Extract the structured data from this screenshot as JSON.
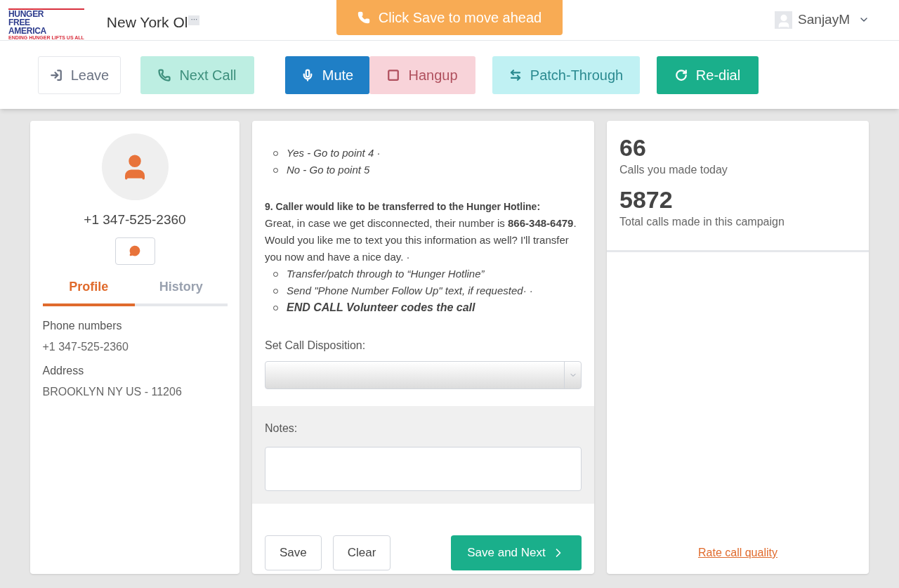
{
  "header": {
    "logo": {
      "lines": [
        "HUNGER",
        "FREE",
        "AMERICA"
      ],
      "tagline": "ENDING HUNGER LIFTS US ALL"
    },
    "campaign_title": "New York Ol",
    "more_label": "···",
    "banner": "Click Save to move ahead",
    "user": {
      "name": "SanjayM"
    }
  },
  "toolbar": [
    {
      "label": "Leave",
      "kind": "leave",
      "disabled": true
    },
    {
      "label": "Next Call",
      "kind": "next",
      "disabled": true
    },
    {
      "label": "Mute",
      "kind": "mute",
      "disabled": false
    },
    {
      "label": "Hangup",
      "kind": "hangup",
      "disabled": true
    },
    {
      "label": "Patch-Through",
      "kind": "patch",
      "disabled": true
    },
    {
      "label": "Re-dial",
      "kind": "redial",
      "disabled": false
    }
  ],
  "contact": {
    "phone": "+1 347-525-2360",
    "tabs": [
      {
        "label": "Profile",
        "selected": true
      },
      {
        "label": "History",
        "selected": false
      }
    ],
    "fields": [
      {
        "label": "Phone numbers",
        "value": "+1 347-525-2360"
      },
      {
        "label": "Address",
        "value": "BROOKLYN NY US - 11206"
      }
    ]
  },
  "script": {
    "options_top": [
      "Yes - Go to point 4 ·",
      "No - Go to point 5"
    ],
    "step_title": "9. Caller would like to be transferred to the Hunger Hotline:",
    "step_text": "Great, in case we get disconnected, their number is **866-348-6479**. Would you like me to text you this information as well? I'll transfer you now and have a nice day. ·",
    "options": [
      {
        "text": "Transfer/patch through to “Hunger Hotline”",
        "bold": false
      },
      {
        "text": "Send \"Phone Number Follow Up\" text, if requested· ·",
        "bold": false
      },
      {
        "text": "END CALL Volunteer codes the call",
        "bold": true
      }
    ],
    "disposition_label": "Set Call Disposition:",
    "notes_label": "Notes:",
    "buttons": [
      {
        "label": "Save",
        "kind": "plain"
      },
      {
        "label": "Clear",
        "kind": "plain"
      },
      {
        "label": "Save and Next",
        "kind": "primary"
      }
    ]
  },
  "stats": [
    {
      "value": "66",
      "label": "Calls you made today"
    },
    {
      "value": "5872",
      "label": "Total calls made in this campaign"
    }
  ],
  "rate_link": "Rate call quality"
}
